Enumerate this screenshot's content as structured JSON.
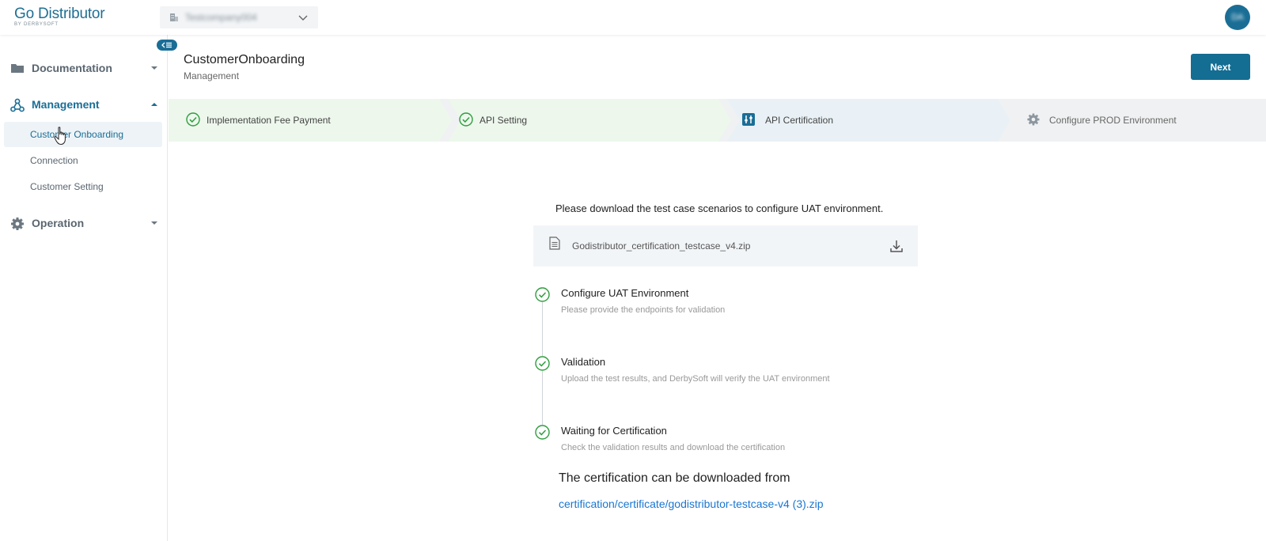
{
  "app": {
    "logo_title": "Go Distributor",
    "logo_subtitle": "BY DERBYSOFT",
    "company_selector": "Testcompany004",
    "avatar_initials": "DA",
    "accent_color": "#146d92"
  },
  "sidebar": {
    "groups": [
      {
        "label": "Documentation",
        "icon": "folder-icon",
        "expanded": false
      },
      {
        "label": "Management",
        "icon": "network-icon",
        "expanded": true,
        "items": [
          "Customer Onboarding",
          "Connection",
          "Customer Setting"
        ],
        "selected": "Customer Onboarding"
      },
      {
        "label": "Operation",
        "icon": "gear-icon",
        "expanded": false
      }
    ]
  },
  "header": {
    "title": "CustomerOnboarding",
    "breadcrumb": "Management",
    "next_label": "Next"
  },
  "stepper": {
    "steps": [
      {
        "label": "Implementation Fee Payment",
        "status": "completed"
      },
      {
        "label": "API Setting",
        "status": "completed"
      },
      {
        "label": "API Certification",
        "status": "active"
      },
      {
        "label": "Configure PROD Environment",
        "status": "pending"
      }
    ]
  },
  "content": {
    "intro": "Please download the test case scenarios to configure UAT environment.",
    "file_name": "Godistributor_certification_testcase_v4.zip",
    "timeline": [
      {
        "title": "Configure UAT Environment",
        "description": "Please provide the endpoints for validation"
      },
      {
        "title": "Validation",
        "description": "Upload the test results, and DerbySoft will verify the UAT environment"
      },
      {
        "title": "Waiting for Certification",
        "description": "Check the validation results and download the certification"
      }
    ],
    "cert_heading": "The certification can be downloaded from",
    "cert_link": "certification/certificate/godistributor-testcase-v4 (3).zip"
  }
}
